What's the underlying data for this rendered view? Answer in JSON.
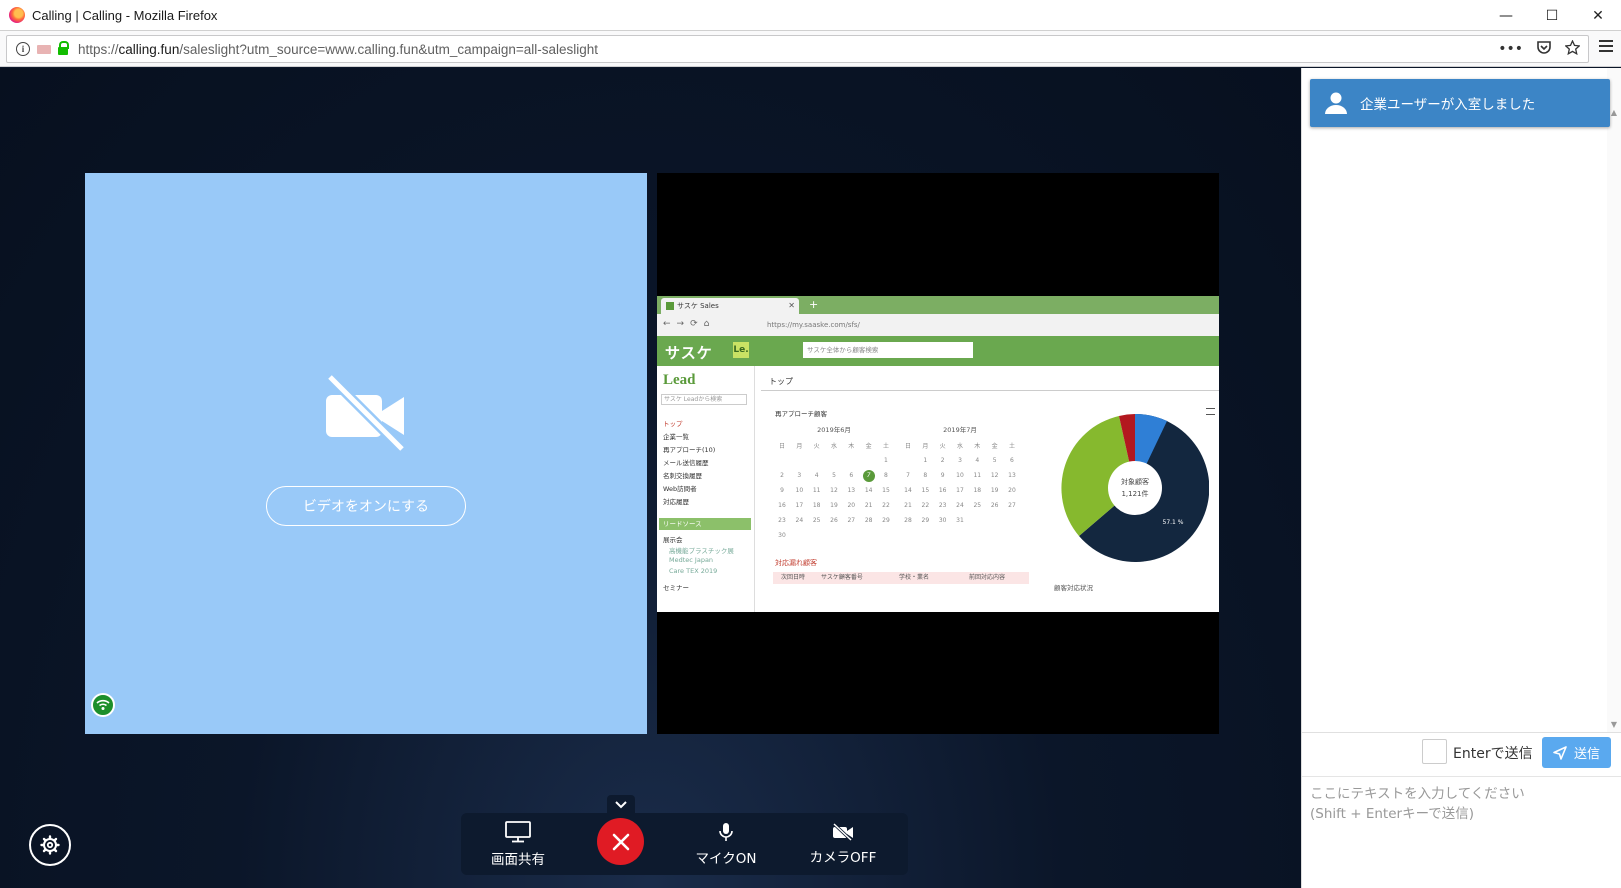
{
  "window": {
    "title": "Calling | Calling - Mozilla Firefox",
    "controls": {
      "minimize": "—",
      "maximize": "☐",
      "close": "✕"
    }
  },
  "address_bar": {
    "url_prefix": "https://",
    "url_domain": "calling.fun",
    "url_rest": "/saleslight?utm_source=www.calling.fun&utm_campaign=all-saleslight",
    "icons": [
      "info-icon",
      "camera-blocked-icon",
      "lock-icon",
      "more-icon",
      "pocket-icon",
      "bookmark-star-icon",
      "menu-icon"
    ]
  },
  "local_video": {
    "background": "#99c9f8",
    "turn_on_video_label": "ビデオをオンにする"
  },
  "shared_screen": {
    "tab_title": "サスケ Sales",
    "address": "https://my.saaske.com/sfs/",
    "brand": "サスケ",
    "brand_badge": "Le.",
    "search_placeholder": "サスケ全体から顧客検索",
    "lead_logo": "Lead",
    "side_search": "サスケ Leadから検索",
    "side_items": [
      "トップ",
      "企業一覧",
      "再アプローチ(10)",
      "メール送信履歴",
      "名刺交換履歴",
      "Web訪問者",
      "対応履歴"
    ],
    "side_section": "リードソース",
    "side_subitems": [
      "展示会",
      "高機能プラスチック展",
      "Medtec Japan",
      "Care TEX 2019",
      "セミナー"
    ],
    "page_title": "トップ",
    "section_title": "再アプローチ顧客",
    "calendar_june": "2019年6月",
    "calendar_july": "2019年7月",
    "weekdays": [
      "日",
      "月",
      "火",
      "水",
      "木",
      "金",
      "土"
    ],
    "table_title": "対応漏れ顧客",
    "table_headers": [
      "次回日時",
      "サスケ顧客番号",
      "学校・業名",
      "前回対応内容"
    ],
    "pie_center_label": "対象顧客",
    "pie_center_value": "1,121件",
    "pie_label_large": "57.1 %",
    "legend_label": "顧客対応状況"
  },
  "controls": {
    "share_screen_label": "画面共有",
    "mic_label": "マイクON",
    "camera_label": "カメラOFF"
  },
  "chat": {
    "toast_message": "企業ユーザーが入室しました",
    "enter_to_send_label": "Enterで送信",
    "send_label": "送信",
    "input_placeholder": "ここにテキストを入力してください\n(Shift + Enterキーで送信)"
  },
  "colors": {
    "stage_bg": "#0b1629",
    "hangup": "#e01b24",
    "toast": "#3c85c6",
    "send_button": "#5aa9ef",
    "signal": "#1d8f2b"
  }
}
